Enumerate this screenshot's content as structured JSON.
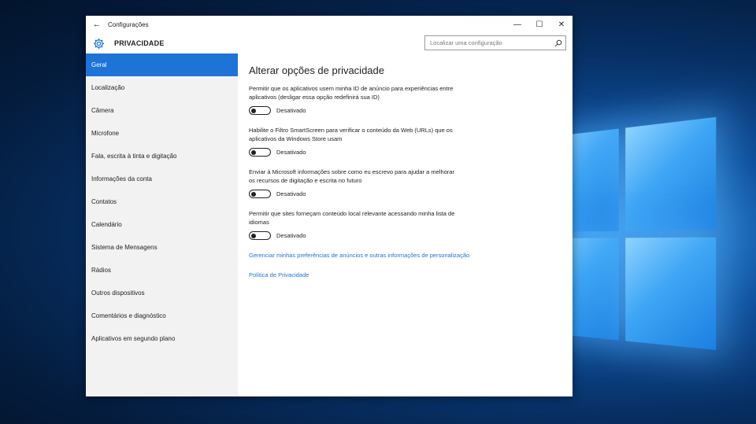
{
  "window": {
    "title": "Configurações",
    "section_title": "PRIVACIDADE",
    "controls": {
      "minimize": "—",
      "maximize": "☐",
      "close": "✕"
    },
    "back_glyph": "←"
  },
  "search": {
    "placeholder": "Localizar uma configuração",
    "icon": "search-icon"
  },
  "sidebar": {
    "items": [
      {
        "label": "Geral",
        "active": true
      },
      {
        "label": "Localização"
      },
      {
        "label": "Câmera"
      },
      {
        "label": "Microfone"
      },
      {
        "label": "Fala, escrita à tinta e digitação"
      },
      {
        "label": "Informações da conta"
      },
      {
        "label": "Contatos"
      },
      {
        "label": "Calendário"
      },
      {
        "label": "Sistema de Mensagens"
      },
      {
        "label": "Rádios"
      },
      {
        "label": "Outros dispositivos"
      },
      {
        "label": "Comentários e diagnóstico"
      },
      {
        "label": "Aplicativos em segundo plano"
      }
    ]
  },
  "main": {
    "heading": "Alterar opções de privacidade",
    "options": [
      {
        "description": "Permitir que os aplicativos usem minha ID de anúncio para experiências entre aplicativos (desligar essa opção redefinirá sua ID)",
        "state": "Desativado"
      },
      {
        "description": "Habilite o Filtro SmartScreen para verificar o conteúdo da Web (URLs) que os aplicativos da Windows Store usam",
        "state": "Desativado"
      },
      {
        "description": "Enviar à Microsoft informações sobre como eu escrevo para ajudar a melhorar os recursos de digitação e escrita no futuro",
        "state": "Desativado"
      },
      {
        "description": "Permitir que sites forneçam conteúdo local relevante acessando minha lista de idiomas",
        "state": "Desativado"
      }
    ],
    "links": [
      "Gerenciar minhas preferências de anúncios e outras informações de personalização",
      "Política de Privacidade"
    ]
  },
  "colors": {
    "accent": "#1e73d6",
    "sidebar_bg": "#f2f2f2",
    "text": "#222222"
  }
}
